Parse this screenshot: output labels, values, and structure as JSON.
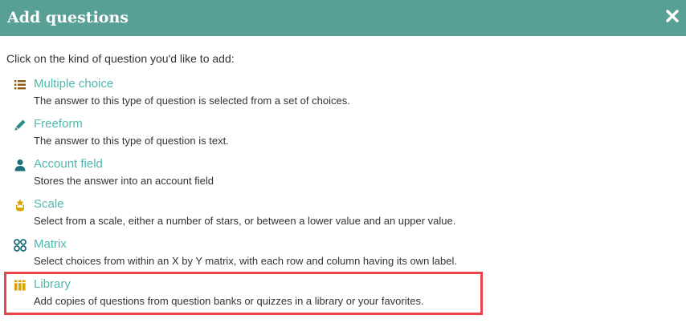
{
  "dialog": {
    "title": "Add questions",
    "close_icon": "close-icon",
    "intro": "Click on the kind of question you'd like to add:"
  },
  "colors": {
    "header_bg": "#589f96",
    "link": "#4fb8ad",
    "text": "#333333",
    "highlight": "#e8424a"
  },
  "options": [
    {
      "icon": "list-icon",
      "icon_color": "#8b5a16",
      "label": "Multiple choice",
      "description": "The answer to this type of question is selected from a set of choices."
    },
    {
      "icon": "pencil-icon",
      "icon_color": "#2e8a86",
      "label": "Freeform",
      "description": "The answer to this type of question is text."
    },
    {
      "icon": "user-icon",
      "icon_color": "#1f6f78",
      "label": "Account field",
      "description": "Stores the answer into an account field"
    },
    {
      "icon": "scale-icon",
      "icon_color": "#d9a400",
      "label": "Scale",
      "description": "Select from a scale, either a number of stars, or between a lower value and an upper value."
    },
    {
      "icon": "matrix-icon",
      "icon_color": "#1f6f78",
      "label": "Matrix",
      "description": "Select choices from within an X by Y matrix, with each row and column having its own label."
    },
    {
      "icon": "library-icon",
      "icon_color": "#d9a400",
      "label": "Library",
      "description": "Add copies of questions from question banks or quizzes in a library or your favorites."
    }
  ]
}
